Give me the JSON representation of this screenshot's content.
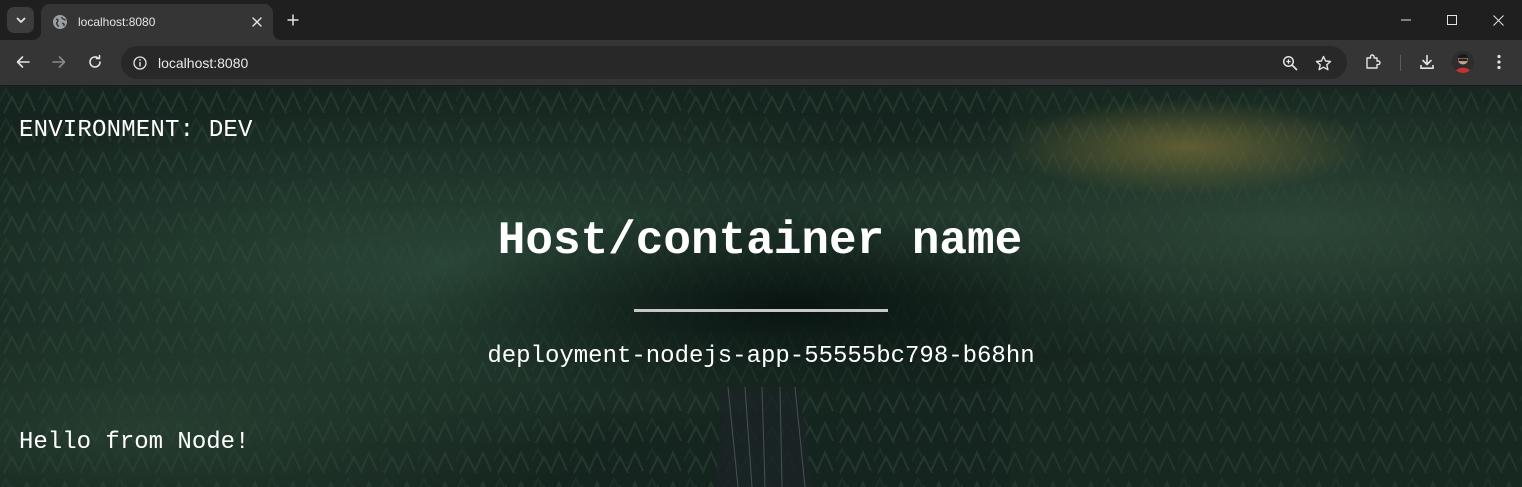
{
  "browser": {
    "tab": {
      "title": "localhost:8080"
    },
    "address_bar": {
      "url": "localhost:8080"
    }
  },
  "page": {
    "environment_label": "ENVIRONMENT: DEV",
    "heading": "Host/container name",
    "host_name": "deployment-nodejs-app-55555bc798-b68hn",
    "greeting": "Hello from Node!"
  },
  "icons": {
    "tab_search": "chevron-down-icon",
    "favicon": "globe-icon",
    "tab_close": "close-icon",
    "new_tab": "plus-icon",
    "minimize": "minimize-icon",
    "maximize": "maximize-icon",
    "close_window": "close-icon",
    "back": "arrow-left-icon",
    "forward": "arrow-right-icon",
    "reload": "reload-icon",
    "site_info": "info-icon",
    "zoom": "zoom-icon",
    "bookmark": "star-icon",
    "extensions": "puzzle-icon",
    "downloads": "download-icon",
    "menu": "kebab-menu-icon"
  },
  "colors": {
    "tabstrip_bg": "#1f1f1f",
    "toolbar_bg": "#353535",
    "omnibox_bg": "#282828",
    "page_text": "#ffffff",
    "forest_dark": "#0f1c18"
  }
}
